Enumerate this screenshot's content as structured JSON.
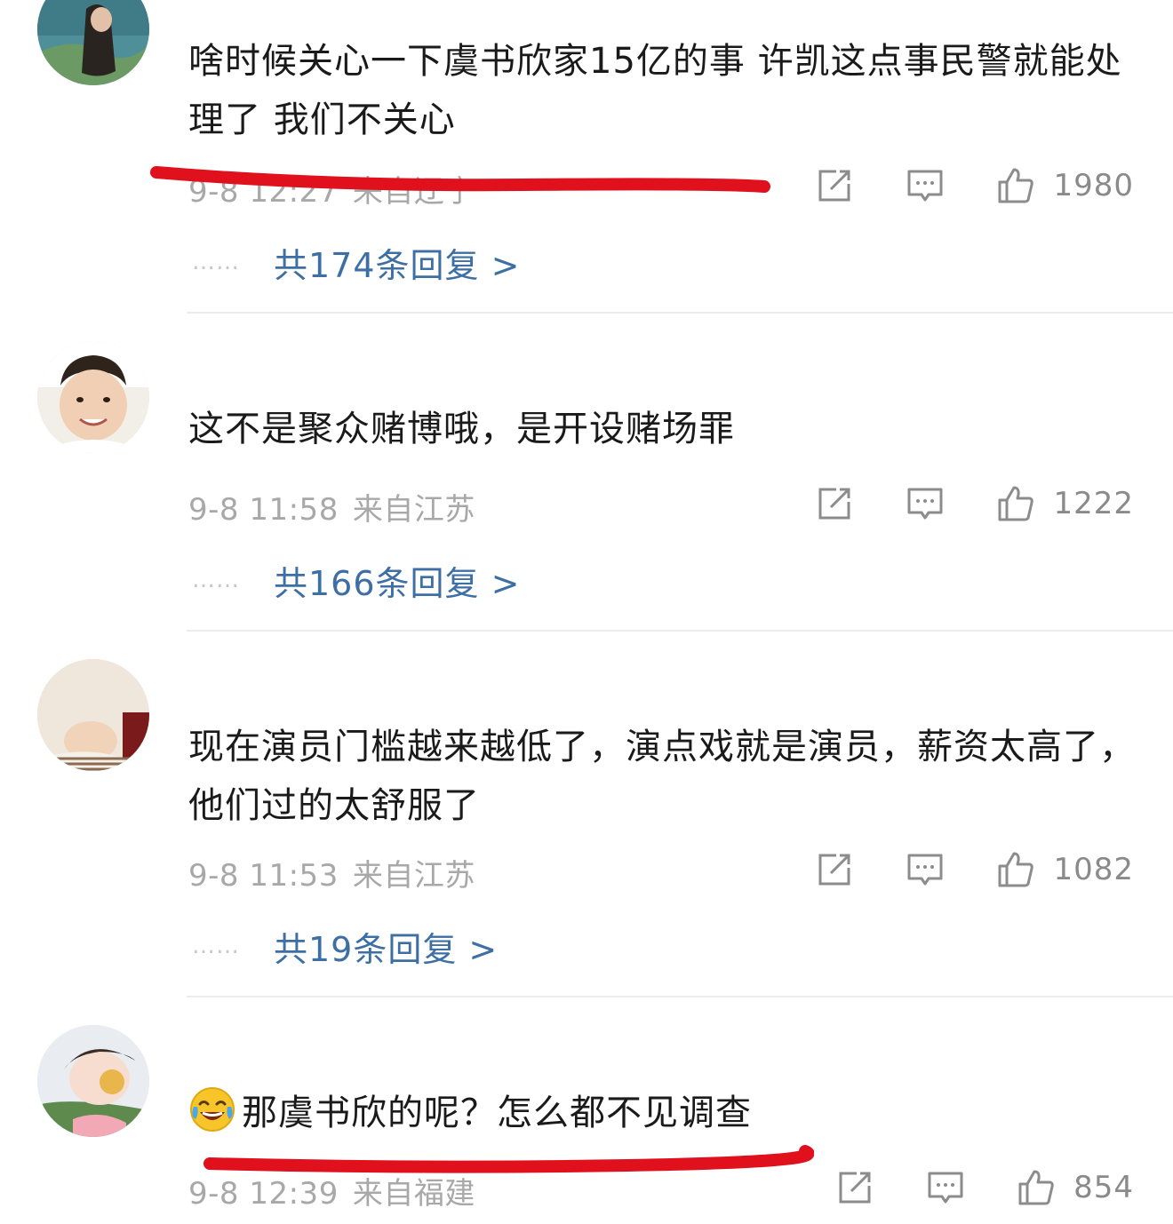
{
  "comments": [
    {
      "text": "啥时候关心一下虞书欣家15亿的事 许凯这点事民警就能处理了 我们不关心",
      "time": "9-8 12:27",
      "source": "来自辽宁",
      "likes": "1980",
      "replies_label": "共174条回复 >",
      "dots": "……"
    },
    {
      "text": "这不是聚众赌博哦，是开设赌场罪",
      "time": "9-8 11:58",
      "source": "来自江苏",
      "likes": "1222",
      "replies_label": "共166条回复 >",
      "dots": "……"
    },
    {
      "text": "现在演员门槛越来越低了，演点戏就是演员，薪资太高了，他们过的太舒服了",
      "time": "9-8 11:53",
      "source": "来自江苏",
      "likes": "1082",
      "replies_label": "共19条回复 >",
      "dots": "……"
    },
    {
      "text": "那虞书欣的呢？怎么都不见调查",
      "emoji": "laughing-crying-emoji",
      "time": "9-8 12:39",
      "source": "来自福建",
      "likes": "854"
    }
  ],
  "colors": {
    "text": "#1a1a1a",
    "meta": "#a8a8a8",
    "link": "#3d6fa4",
    "annotation_red": "#e0101c"
  },
  "icons": [
    "share-icon",
    "comment-icon",
    "like-icon"
  ]
}
